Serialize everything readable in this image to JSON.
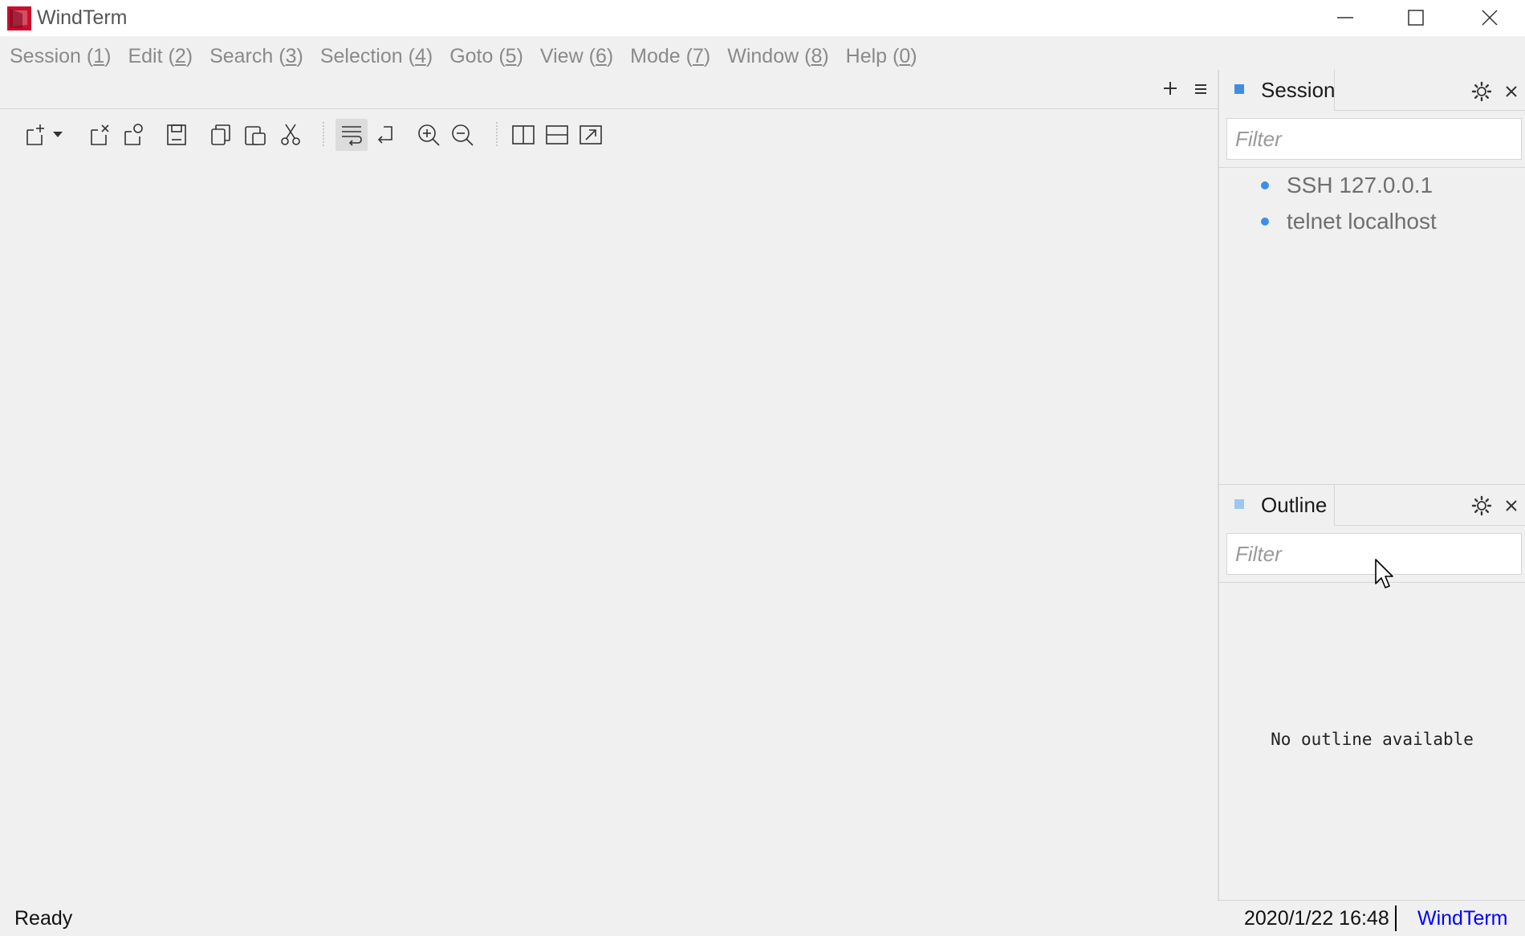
{
  "window": {
    "title": "WindTerm",
    "logo_color": "#c8102e"
  },
  "menu": [
    {
      "label": "Session",
      "accel": "1"
    },
    {
      "label": "Edit",
      "accel": "2"
    },
    {
      "label": "Search",
      "accel": "3"
    },
    {
      "label": "Selection",
      "accel": "4"
    },
    {
      "label": "Goto",
      "accel": "5"
    },
    {
      "label": "View",
      "accel": "6"
    },
    {
      "label": "Mode",
      "accel": "7"
    },
    {
      "label": "Window",
      "accel": "8"
    },
    {
      "label": "Help",
      "accel": "0"
    }
  ],
  "toolbar": {
    "buttons": [
      "new-session-icon",
      "dropdown-icon",
      "close-session-icon",
      "duplicate-session-icon",
      "save-icon",
      "copy-icon",
      "paste-icon",
      "cut-icon",
      "word-wrap-icon",
      "line-wrap-icon",
      "zoom-in-icon",
      "zoom-out-icon",
      "split-vertical-icon",
      "split-horizontal-icon",
      "popout-icon"
    ],
    "active": "word-wrap-icon"
  },
  "session_panel": {
    "title": "Session",
    "marker_color": "#3f8ee6",
    "filter_placeholder": "Filter",
    "filter_value": "",
    "items": [
      {
        "label": "SSH 127.0.0.1"
      },
      {
        "label": "telnet localhost"
      }
    ]
  },
  "outline_panel": {
    "title": "Outline",
    "marker_color": "#9cc8f0",
    "filter_placeholder": "Filter",
    "filter_value": "",
    "empty_message": "No outline available"
  },
  "statusbar": {
    "status": "Ready",
    "datetime": "2020/1/22 16:48",
    "app_name": "WindTerm",
    "app_name_color": "#0000ff"
  }
}
